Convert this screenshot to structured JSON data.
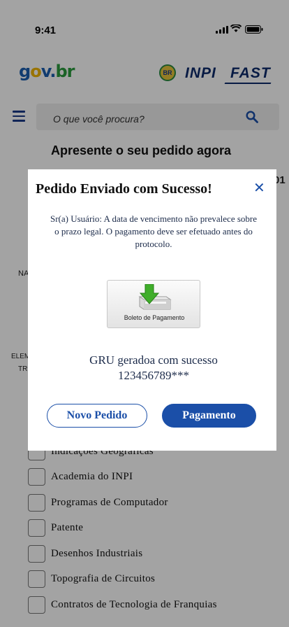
{
  "status_bar": {
    "time": "9:41"
  },
  "header": {
    "logo_gov": {
      "g": "g",
      "o": "o",
      "v": "v",
      "dot": ".",
      "br": "br"
    },
    "br_badge": "BR",
    "inpi": "INPI",
    "fast": "FAST"
  },
  "search": {
    "placeholder": "O que você procura?"
  },
  "page": {
    "headline": "Apresente o seu pedido agora",
    "partial_texts": {
      "right_fragment": "01",
      "left_fragment_1": "NA",
      "left_fragment_2": "ELEM",
      "left_fragment_3": "TR"
    }
  },
  "checklist": [
    {
      "label": "Indicações Geográficas"
    },
    {
      "label": "Academia do INPI"
    },
    {
      "label": "Programas de Computador"
    },
    {
      "label": "Patente"
    },
    {
      "label": "Desenhos Industriais"
    },
    {
      "label": "Topografia de Circuitos"
    },
    {
      "label": "Contratos de Tecnologia de Franquias"
    }
  ],
  "modal": {
    "title": "Pedido Enviado com Sucesso!",
    "close_symbol": "✕",
    "message": "Sr(a) Usuário: A data de vencimento não prevalece sobre o prazo legal. O pagamento deve ser efetuado antes do protocolo.",
    "boleto_label": "Boleto de Pagamento",
    "gru_line1": "GRU geradoa com sucesso",
    "gru_line2": "123456789***",
    "btn_novo": "Novo Pedido",
    "btn_pagamento": "Pagamento"
  },
  "colors": {
    "primary": "#1b4fa8",
    "overlay": "rgba(0,0,0,0.36)",
    "brand_dark": "#0d2b6b"
  }
}
